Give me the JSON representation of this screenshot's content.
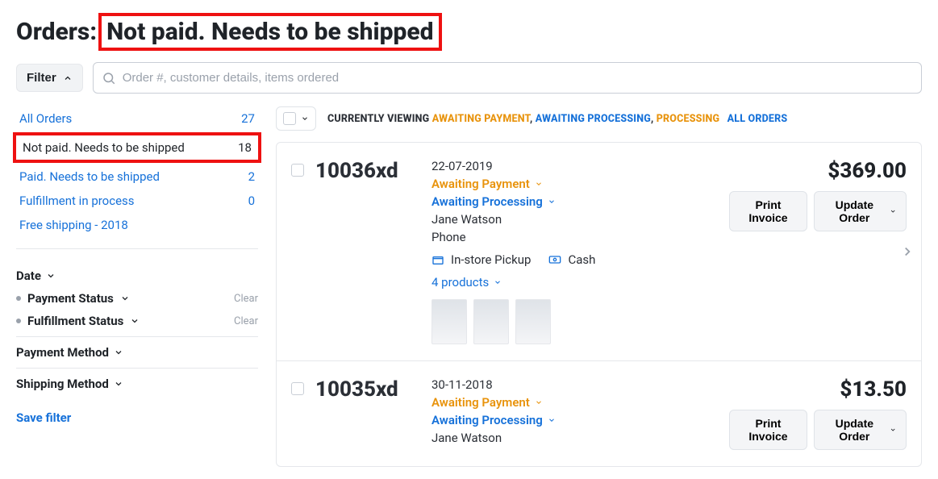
{
  "header": {
    "title_prefix": "Orders:",
    "title_highlight": "Not paid. Needs to be shipped"
  },
  "toolbar": {
    "filter_label": "Filter",
    "search_placeholder": "Order #, customer details, items ordered"
  },
  "sidebar": {
    "filters": [
      {
        "label": "All Orders",
        "count": "27",
        "active": false
      },
      {
        "label": "Not paid. Needs to be shipped",
        "count": "18",
        "active": true
      },
      {
        "label": "Paid. Needs to be shipped",
        "count": "2",
        "active": false
      },
      {
        "label": "Fulfillment in process",
        "count": "0",
        "active": false
      },
      {
        "label": "Free shipping - 2018",
        "count": "",
        "active": false
      }
    ],
    "facets": {
      "date_label": "Date",
      "payment_status_label": "Payment Status",
      "fulfillment_status_label": "Fulfillment Status",
      "payment_method_label": "Payment Method",
      "shipping_method_label": "Shipping Method",
      "clear_label": "Clear"
    },
    "save_filter_label": "Save filter"
  },
  "viewing": {
    "prefix": "CURRENTLY VIEWING",
    "awaiting_payment": "AWAITING PAYMENT",
    "awaiting_processing": "AWAITING PROCESSING",
    "processing": "PROCESSING",
    "all_orders": "ALL ORDERS",
    "comma": ","
  },
  "buttons": {
    "print_invoice": "Print Invoice",
    "update_order": "Update Order"
  },
  "orders": [
    {
      "number": "10036xd",
      "date": "22-07-2019",
      "payment_status": "Awaiting Payment",
      "fulfillment_status": "Awaiting Processing",
      "customer": "Jane Watson",
      "contact": "Phone",
      "shipping": "In-store Pickup",
      "payment_method": "Cash",
      "products_label": "4 products",
      "price": "$369.00",
      "thumbs": 3
    },
    {
      "number": "10035xd",
      "date": "30-11-2018",
      "payment_status": "Awaiting Payment",
      "fulfillment_status": "Awaiting Processing",
      "customer": "Jane Watson",
      "contact": "",
      "shipping": "",
      "payment_method": "",
      "products_label": "",
      "price": "$13.50",
      "thumbs": 0
    }
  ]
}
